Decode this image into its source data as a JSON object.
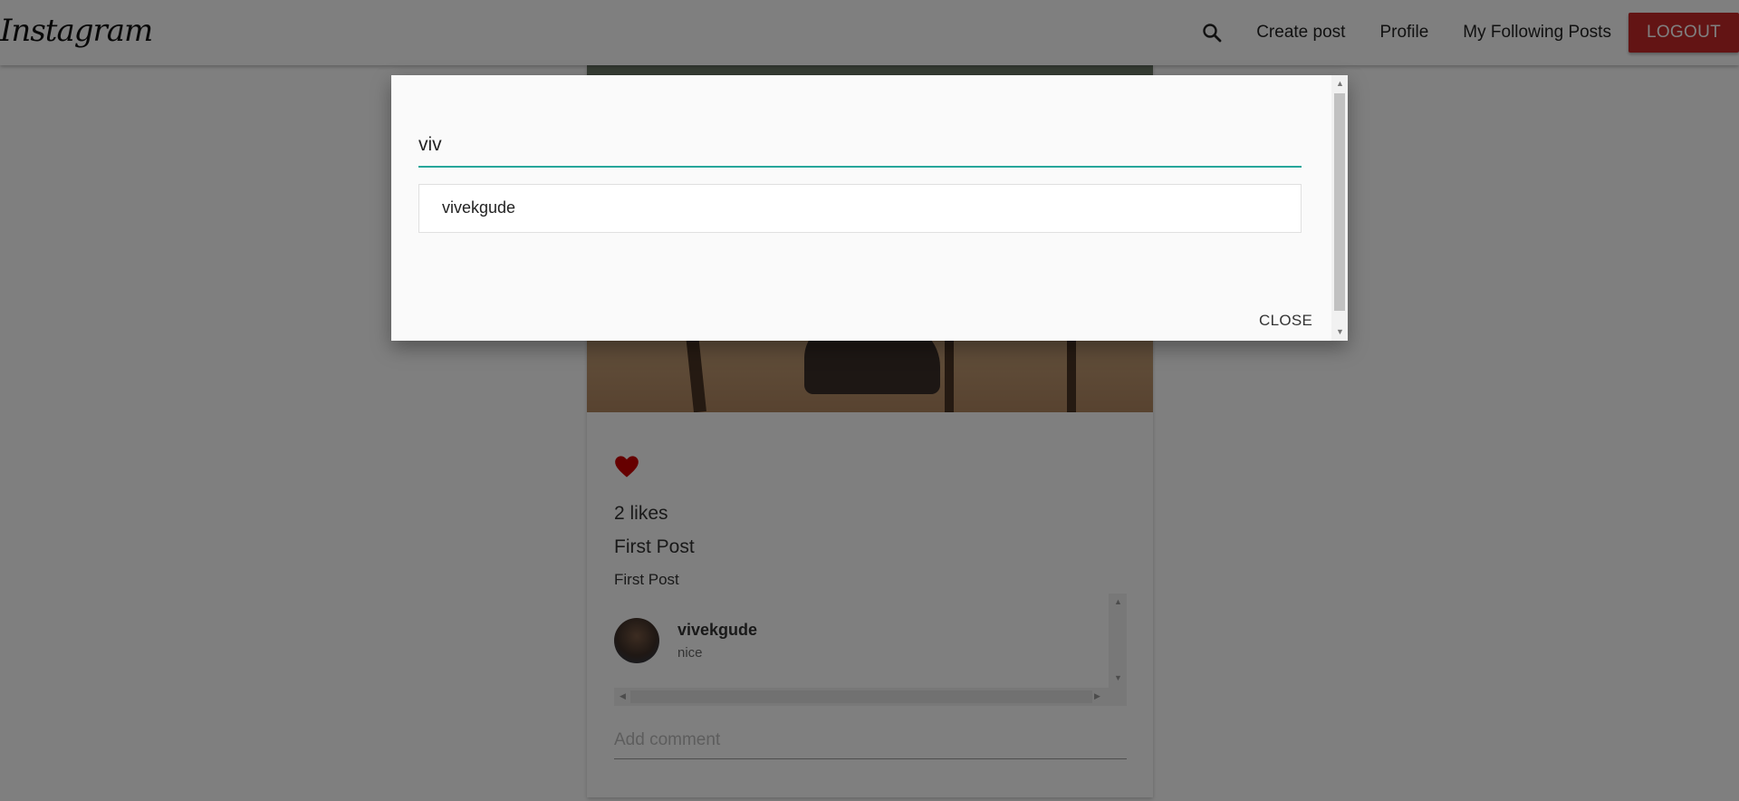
{
  "navbar": {
    "logo": "Instagram",
    "links": [
      "Create post",
      "Profile",
      "My Following Posts"
    ],
    "logout_label": "LOGOUT"
  },
  "post": {
    "likes": "2 likes",
    "title": "First Post",
    "body": "First Post",
    "comments": [
      {
        "user": "vivekgude",
        "text": "nice"
      }
    ],
    "add_comment_placeholder": "Add comment"
  },
  "search_modal": {
    "query": "viv",
    "results": [
      "vivekgude"
    ],
    "close_label": "CLOSE"
  },
  "colors": {
    "accent": "#26a69a",
    "logout": "#c62828",
    "heart": "#cc0000"
  },
  "icons": {
    "search": "search-icon",
    "like": "heart-icon"
  }
}
